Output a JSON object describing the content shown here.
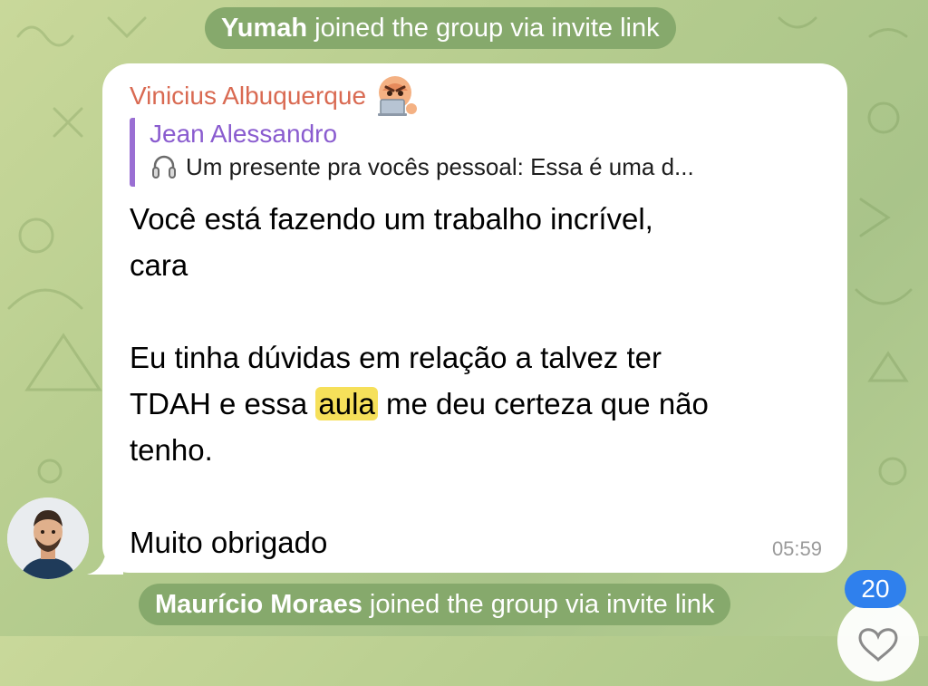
{
  "service_messages": [
    {
      "name": "Yumah",
      "text": "joined the group via invite link"
    },
    {
      "name": "Maurício Moraes",
      "text": "joined the group via invite link"
    }
  ],
  "message": {
    "sender": "Vinicius Albuquerque",
    "sender_emoji_icon": "angry-face-laptop-icon",
    "reply": {
      "author": "Jean Alessandro",
      "icon": "headphones-icon",
      "preview": "Um presente pra vocês pessoal: Essa é uma d..."
    },
    "lines": {
      "l1": "Você está fazendo um trabalho incrível,",
      "l2": "cara",
      "l3": "Eu tinha dúvidas em relação a talvez ter",
      "l4_before": "TDAH e essa",
      "l4_highlight": "aula",
      "l4_after": "me deu certeza que não",
      "l5": "tenho.",
      "l6": "Muito obrigado"
    },
    "time": "05:59"
  },
  "scroll_badge": {
    "count": "20",
    "icon": "heart-icon"
  },
  "colors": {
    "sender": "#d96a52",
    "reply_accent": "#9a6fd3",
    "highlight": "#f6e05a",
    "badge": "#2f80ed",
    "service_pill": "#86a96c"
  }
}
